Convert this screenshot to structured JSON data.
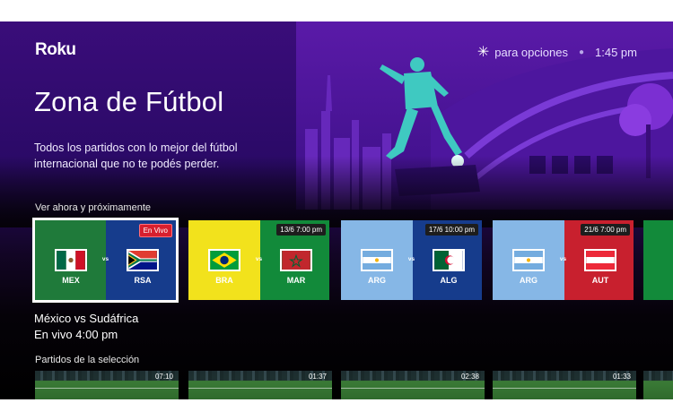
{
  "brand": "Roku",
  "top_bar": {
    "options_label": "para opciones",
    "clock": "1:45 pm"
  },
  "hero": {
    "title": "Zona de Fútbol",
    "description": "Todos los partidos con lo mejor del fútbol internacional que no te podés perder."
  },
  "sections": {
    "upcoming_label": "Ver ahora y próximamente",
    "highlights_label": "Partidos de la selección"
  },
  "matches": [
    {
      "home": "MEX",
      "away": "RSA",
      "badge": "En Vivo",
      "badge_type": "live",
      "home_color": "#1f7a3a",
      "away_color": "#163c8c"
    },
    {
      "home": "BRA",
      "away": "MAR",
      "badge": "13/6 7:00 pm",
      "badge_type": "time",
      "home_color": "#f2e21c",
      "away_color": "#128a3a"
    },
    {
      "home": "ARG",
      "away": "ALG",
      "badge": "17/6 10:00 pm",
      "badge_type": "time",
      "home_color": "#86b7e6",
      "away_color": "#163c8c"
    },
    {
      "home": "ARG",
      "away": "AUT",
      "badge": "21/6 7:00 pm",
      "badge_type": "time",
      "home_color": "#86b7e6",
      "away_color": "#c8202e"
    }
  ],
  "selected_match": {
    "title": "México vs Sudáfrica",
    "time": "En vivo 4:00 pm"
  },
  "vs_label": "vs",
  "highlights": [
    {
      "duration": "07:10"
    },
    {
      "duration": "01:37"
    },
    {
      "duration": "02:38"
    },
    {
      "duration": "01:33"
    }
  ],
  "icons": [
    "asterisk-icon"
  ]
}
